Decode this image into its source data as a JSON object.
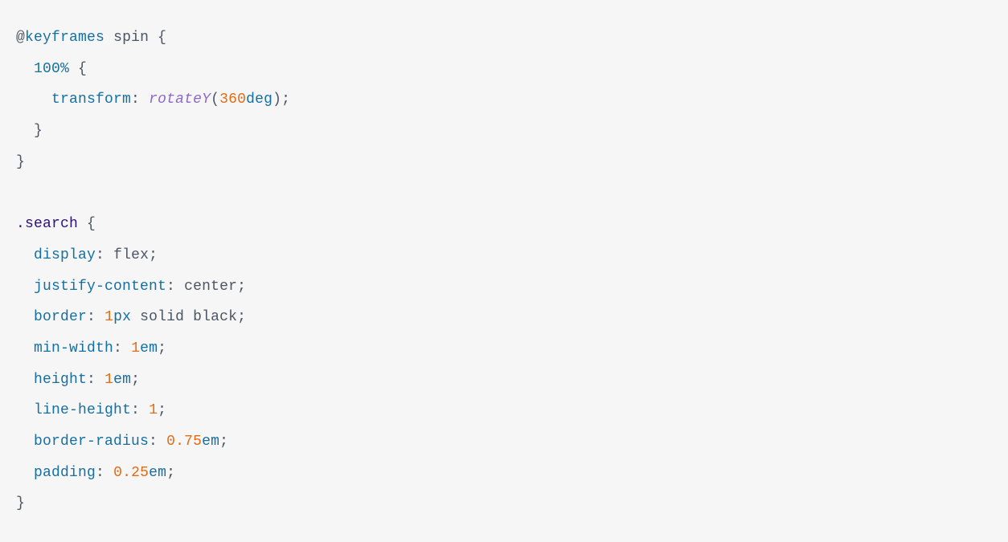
{
  "code": {
    "line1": {
      "at": "@",
      "keyframes": "keyframes",
      "name": "spin",
      "brace": "{"
    },
    "line2": {
      "indent": "  ",
      "percent": "100%",
      "brace": "{"
    },
    "line3": {
      "indent": "    ",
      "prop": "transform",
      "colon": ":",
      "func": "rotateY",
      "lparen": "(",
      "num": "360",
      "unit": "deg",
      "rparen": ")",
      "semi": ";"
    },
    "line4": {
      "indent": "  ",
      "brace": "}"
    },
    "line5": {
      "brace": "}"
    },
    "line6": {
      "blank": ""
    },
    "line7": {
      "selector": ".search",
      "brace": "{"
    },
    "line8": {
      "indent": "  ",
      "prop": "display",
      "colon": ":",
      "val": "flex",
      "semi": ";"
    },
    "line9": {
      "indent": "  ",
      "prop": "justify-content",
      "colon": ":",
      "val": "center",
      "semi": ";"
    },
    "line10": {
      "indent": "  ",
      "prop": "border",
      "colon": ":",
      "num": "1",
      "unit": "px",
      "val": "solid black",
      "semi": ";"
    },
    "line11": {
      "indent": "  ",
      "prop": "min-width",
      "colon": ":",
      "num": "1",
      "unit": "em",
      "semi": ";"
    },
    "line12": {
      "indent": "  ",
      "prop": "height",
      "colon": ":",
      "num": "1",
      "unit": "em",
      "semi": ";"
    },
    "line13": {
      "indent": "  ",
      "prop": "line-height",
      "colon": ":",
      "num": "1",
      "semi": ";"
    },
    "line14": {
      "indent": "  ",
      "prop": "border-radius",
      "colon": ":",
      "num": "0.75",
      "unit": "em",
      "semi": ";"
    },
    "line15": {
      "indent": "  ",
      "prop": "padding",
      "colon": ":",
      "num": "0.25",
      "unit": "em",
      "semi": ";"
    },
    "line16": {
      "brace": "}"
    }
  }
}
